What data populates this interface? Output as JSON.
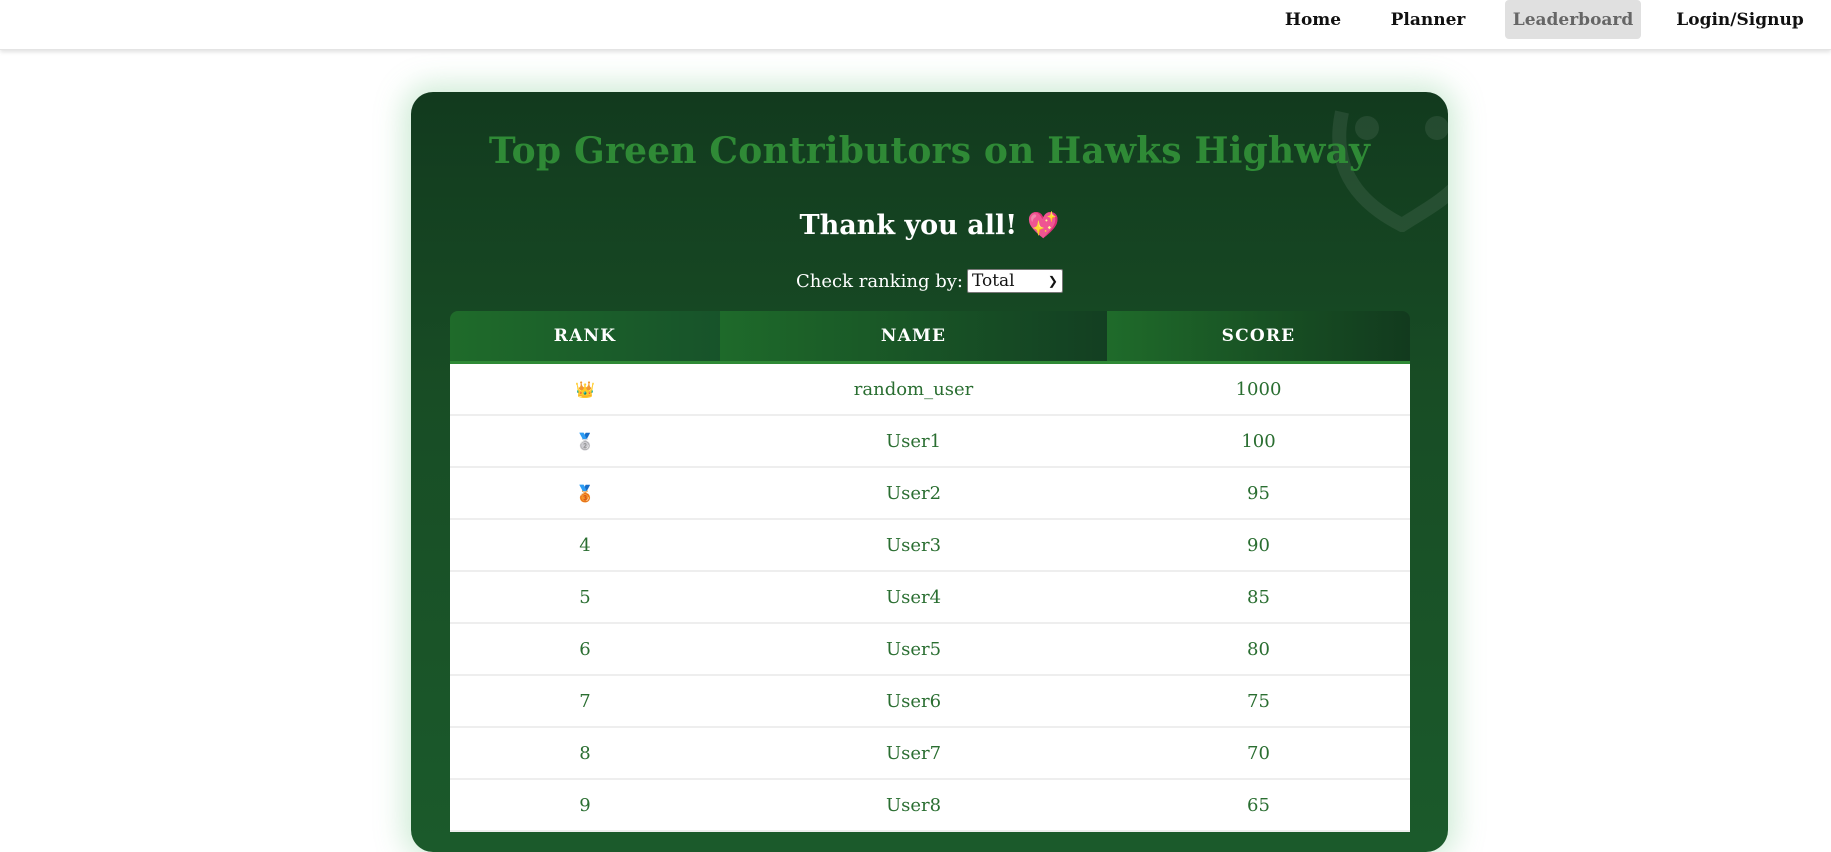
{
  "nav": {
    "home": "Home",
    "planner": "Planner",
    "leaderboard": "Leaderboard",
    "login": "Login/Signup",
    "active": "Leaderboard"
  },
  "page": {
    "title": "Top Green Contributors on Hawks Highway",
    "thanks": "Thank you all!",
    "thanks_emoji": "💖",
    "filter_label": "Check ranking by:",
    "filter_value": "Total"
  },
  "table": {
    "headers": [
      "RANK",
      "NAME",
      "SCORE"
    ],
    "rows": [
      {
        "rank": "👑",
        "name": "random_user",
        "score": "1000"
      },
      {
        "rank": "🥈",
        "name": "User1",
        "score": "100"
      },
      {
        "rank": "🥉",
        "name": "User2",
        "score": "95"
      },
      {
        "rank": "4",
        "name": "User3",
        "score": "90"
      },
      {
        "rank": "5",
        "name": "User4",
        "score": "85"
      },
      {
        "rank": "6",
        "name": "User5",
        "score": "80"
      },
      {
        "rank": "7",
        "name": "User6",
        "score": "75"
      },
      {
        "rank": "8",
        "name": "User7",
        "score": "70"
      },
      {
        "rank": "9",
        "name": "User8",
        "score": "65"
      }
    ]
  },
  "colors": {
    "accent": "#2f8a36",
    "card_dark": "#123a1e",
    "text_green": "#2a6e31"
  },
  "icons": {
    "heart": "sparkling-heart-icon",
    "rank_1": "crown-icon",
    "rank_2": "silver-medal-icon",
    "rank_3": "bronze-medal-icon",
    "filter_chevron": "chevron-down-icon",
    "card_decoration": "leaf-face-icon"
  }
}
